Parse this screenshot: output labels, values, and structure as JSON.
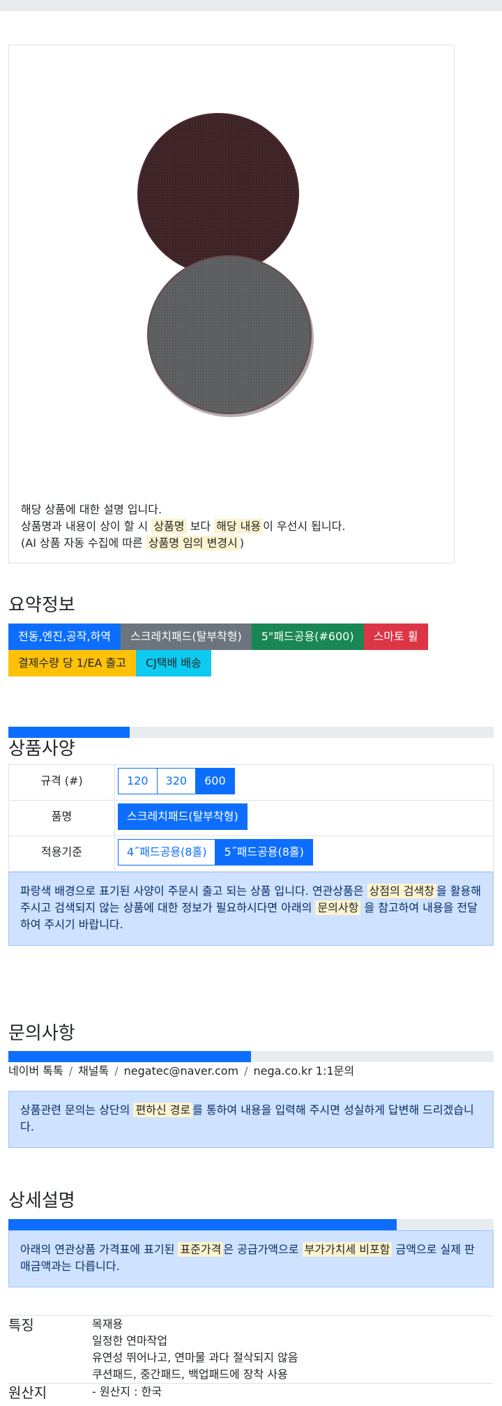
{
  "product_image": {
    "icon": "sanding-pad-pair-image",
    "pad_colors": {
      "top": "#3d2326",
      "bottom": "#5b5d5f"
    }
  },
  "caption": {
    "line1": "해당 상품에 대한 설명 입니다.",
    "line2_a": "상품명과 내용이 상이 할 시 ",
    "line2_mark1": "상품명",
    "line2_b": " 보다 ",
    "line2_mark2": "해당 내용",
    "line2_c": "이 우선시 됩니다.",
    "line3_a": "(AI 상품 자동 수집에 따른 ",
    "line3_mark": "상품명 임의 변경시",
    "line3_b": ")"
  },
  "summary": {
    "title": "요약정보",
    "tags_row1": [
      "전동,엔진,공작,하역",
      "스크레치패드(탈부착형)",
      "5\"패드공용(#600)",
      "스마토 휠"
    ],
    "tags_row2": [
      "결제수량 당 1/EA 출고",
      "CJ택배 배송"
    ]
  },
  "progress_values": {
    "spec": 0.25,
    "inquiry": 0.5,
    "detail": 0.8
  },
  "spec": {
    "title": "상품사양",
    "rows": [
      {
        "label": "규격 (#)",
        "options": [
          "120",
          "320",
          "600"
        ],
        "selected": "600"
      },
      {
        "label": "품명",
        "options": [
          "스크레치패드(탈부착형)"
        ],
        "selected": "스크레치패드(탈부착형)"
      },
      {
        "label": "적용기준",
        "options": [
          "4˝패드공용(8홀)",
          "5˝패드공용(8홀)"
        ],
        "selected": "5˝패드공용(8홀)"
      }
    ],
    "notice_a": "파랑색 배경으로 표기된 사양이 주문시 출고 되는 상품 입니다. 연관상품은 ",
    "notice_mark1": "상점의 검색창",
    "notice_b": "을 활용해 주시고 검색되지 않는 상품에 대한 정보가 필요하시다면 아래의 ",
    "notice_mark2": "문의사항",
    "notice_c": " 을 참고하여 내용을 전달하여 주시기 바랍니다."
  },
  "inquiry": {
    "title": "문의사항",
    "links": [
      "네이버 톡톡",
      "채널톡",
      "negatec@naver.com",
      "nega.co.kr 1:1문의"
    ],
    "separator": "/",
    "notice_a": "상품관련 문의는 상단의 ",
    "notice_mark": "편하신 경로",
    "notice_b": "를 통하여 내용을 입력해 주시면 성실하게 답변해 드리겠습니다."
  },
  "detail": {
    "title": "상세설명",
    "notice_a": "아래의 연관상품 가격표에 표기된 ",
    "notice_mark1": "표준가격",
    "notice_b": "은 공급가액으로 ",
    "notice_mark2": "부가가치세 비포함",
    "notice_c": " 금액으로 실제 판매금액과는 다릅니다.",
    "features_term": "특징",
    "features": [
      "목재용",
      "일정한 연마작업",
      "유연성 뛰어나고, 연마물 과다 절삭되지 않음",
      "쿠션패드, 중간패드, 백업패드에 장착 사용"
    ],
    "origin_term": "원산지",
    "origin": [
      "- 원산지 : 한국"
    ]
  }
}
